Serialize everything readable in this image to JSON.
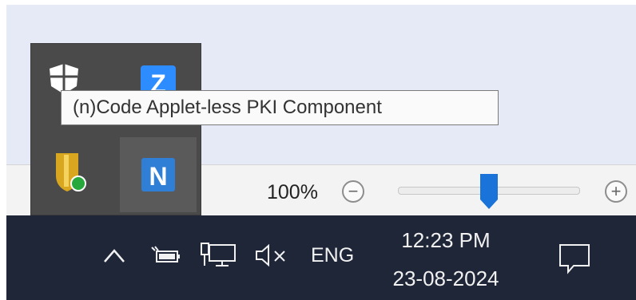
{
  "tooltip": {
    "text": "(n)Code Applet-less PKI Component"
  },
  "tray_popup": {
    "icons": [
      "windows-defender-icon",
      "zoom-app-icon",
      "security-shield-icon",
      "ncode-app-icon"
    ],
    "z_letter": "Z",
    "n_letter": "N"
  },
  "zoom": {
    "value": "100%",
    "minus_symbol": "−",
    "plus_symbol": "+",
    "level": 0.5
  },
  "taskbar": {
    "language": "ENG",
    "time": "12:23 PM",
    "date": "23-08-2024",
    "system_icons": [
      "chevron-up-icon",
      "battery-icon",
      "network-icon",
      "volume-muted-icon",
      "notification-icon"
    ]
  },
  "colors": {
    "taskbar_bg": "#1f2638",
    "popup_bg": "#4a4a4a",
    "accent_blue": "#1a73d9",
    "window_bg": "#e6e9f6"
  }
}
